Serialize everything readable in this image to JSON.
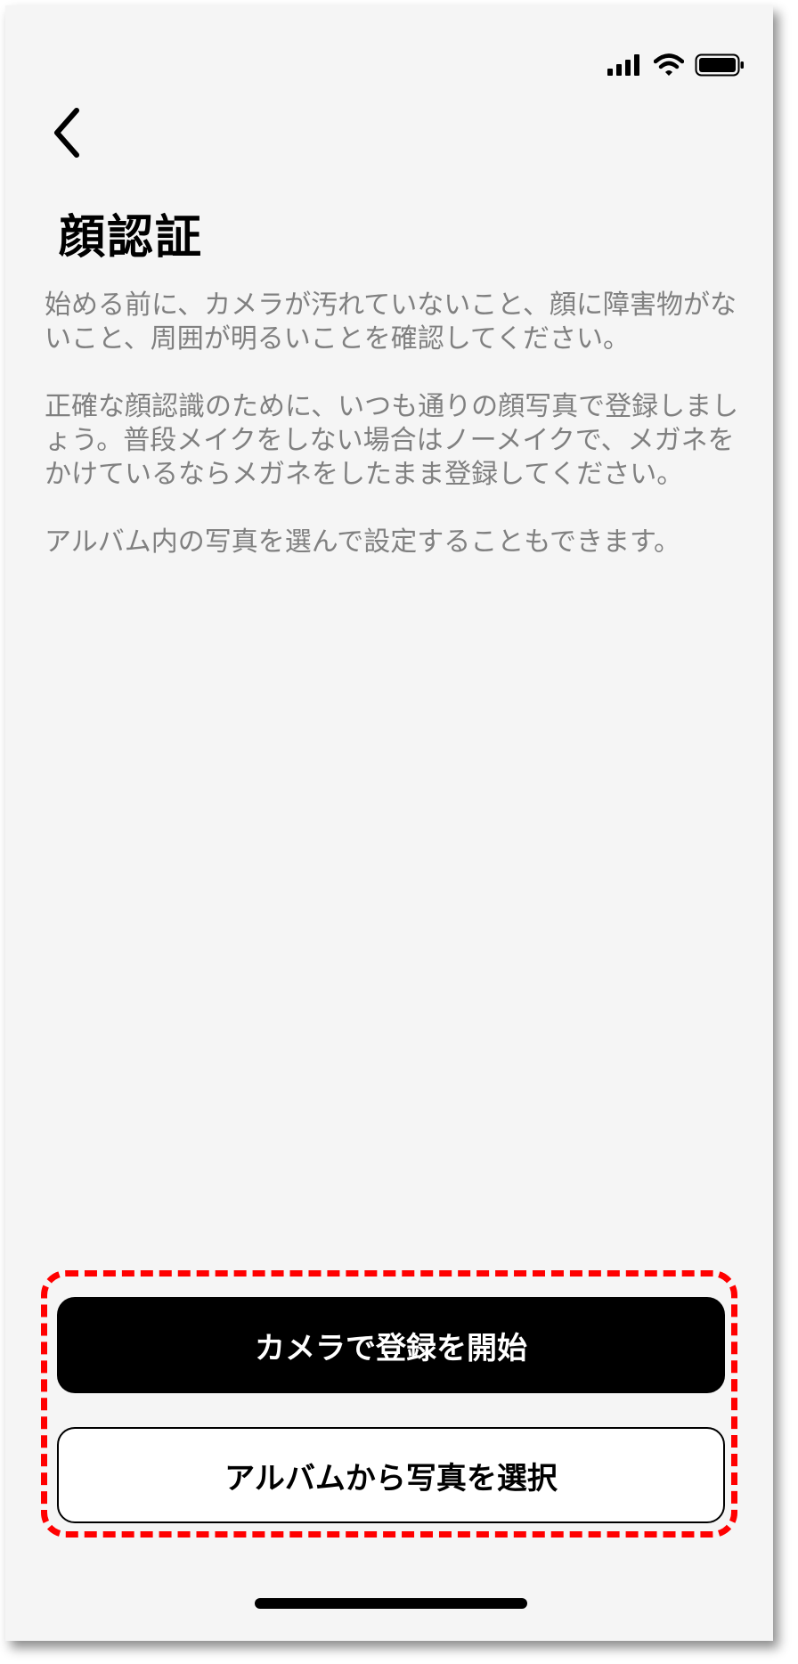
{
  "status_bar": {
    "signal_icon": "cellular-signal-icon",
    "wifi_icon": "wifi-icon",
    "battery_icon": "battery-icon"
  },
  "header": {
    "back_icon": "chevron-left-icon",
    "title": "顔認証"
  },
  "content": {
    "paragraphs": [
      "始める前に、カメラが汚れていないこと、顔に障害物がないこと、周囲が明るいことを確認してください。",
      "正確な顔認識のために、いつも通りの顔写真で登録しましょう。普段メイクをしない場合はノーメイクで、メガネをかけているならメガネをしたまま登録してください。",
      "アルバム内の写真を選んで設定することもできます。"
    ]
  },
  "actions": {
    "primary_label": "カメラで登録を開始",
    "secondary_label": "アルバムから写真を選択"
  },
  "colors": {
    "background": "#f5f5f5",
    "body_text": "#808080",
    "highlight": "#ff0000",
    "primary_button": "#000000"
  }
}
